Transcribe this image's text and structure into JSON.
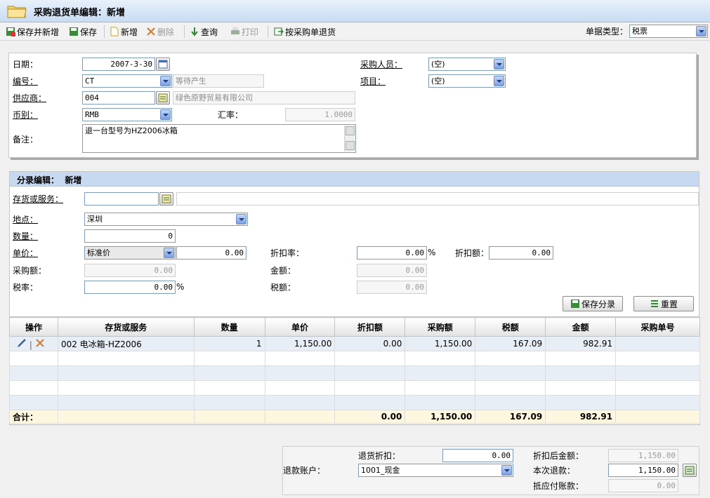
{
  "window": {
    "title": "采购退货单编辑：新增"
  },
  "toolbar": {
    "save_new": "保存并新增",
    "save": "保存",
    "new": "新增",
    "delete": "删除",
    "query": "查询",
    "print": "打印",
    "return_by_po": "按采购单退货",
    "doc_type_label": "单据类型：",
    "doc_type_value": "税票"
  },
  "header": {
    "date_label": "日期：",
    "date_value": "2007-3-30",
    "number_label": "编号：",
    "number_value": "CT",
    "number_hint": "等待产生",
    "supplier_label": "供应商：",
    "supplier_code": "004",
    "supplier_name": "绿色原野贸易有限公司",
    "currency_label": "币别：",
    "currency_value": "RMB",
    "rate_label": "汇率：",
    "rate_value": "1.0000",
    "remark_label": "备注：",
    "remark_value": "退一台型号为HZ2006冰箱",
    "buyer_label": "采购人员：",
    "buyer_value": "(空)",
    "project_label": "项目：",
    "project_value": "(空)"
  },
  "entry": {
    "section_title": "分录编辑：  新增",
    "item_label": "存货或服务：",
    "item_value": "",
    "location_label": "地点：",
    "location_value": "深圳",
    "qty_label": "数量：",
    "qty_value": "0",
    "price_label": "单价：",
    "price_type": "标准价",
    "price_value": "0.00",
    "discount_rate_label": "折扣率：",
    "discount_rate_value": "0.00",
    "percent": "%",
    "discount_amount_label": "折扣额：",
    "discount_amount_value": "0.00",
    "purchase_amount_label": "采购额：",
    "purchase_amount_value": "0.00",
    "amount_label": "金额：",
    "amount_value": "0.00",
    "tax_rate_label": "税率：",
    "tax_rate_value": "0.00",
    "tax_label": "税额：",
    "tax_value": "0.00",
    "save_entry": "保存分录",
    "reset": "重置"
  },
  "grid": {
    "columns": [
      "操作",
      "存货或服务",
      "数量",
      "单价",
      "折扣额",
      "采购额",
      "税额",
      "金额",
      "采购单号"
    ],
    "rows": [
      {
        "item": "002 电冰箱-HZ2006",
        "qty": "1",
        "price": "1,150.00",
        "discount": "0.00",
        "purchase": "1,150.00",
        "tax": "167.09",
        "amount": "982.91",
        "po": ""
      }
    ],
    "total_label": "合计：",
    "totals": {
      "discount": "0.00",
      "purchase": "1,150.00",
      "tax": "167.09",
      "amount": "982.91"
    }
  },
  "footer": {
    "return_discount_label": "退货折扣：",
    "return_discount_value": "0.00",
    "after_discount_label": "折扣后金额：",
    "after_discount_value": "1,150.00",
    "refund_account_label": "退款账户：",
    "refund_account_value": "1001_现金",
    "this_refund_label": "本次退款：",
    "this_refund_value": "1,150.00",
    "offset_payable_label": "抵应付账款：",
    "offset_payable_value": "0.00"
  },
  "colors": {
    "title_bar": "#c9dcf2",
    "section_header": "#c6d9f0",
    "total_row": "#fdf7df",
    "alt_row": "#e8eef6"
  }
}
